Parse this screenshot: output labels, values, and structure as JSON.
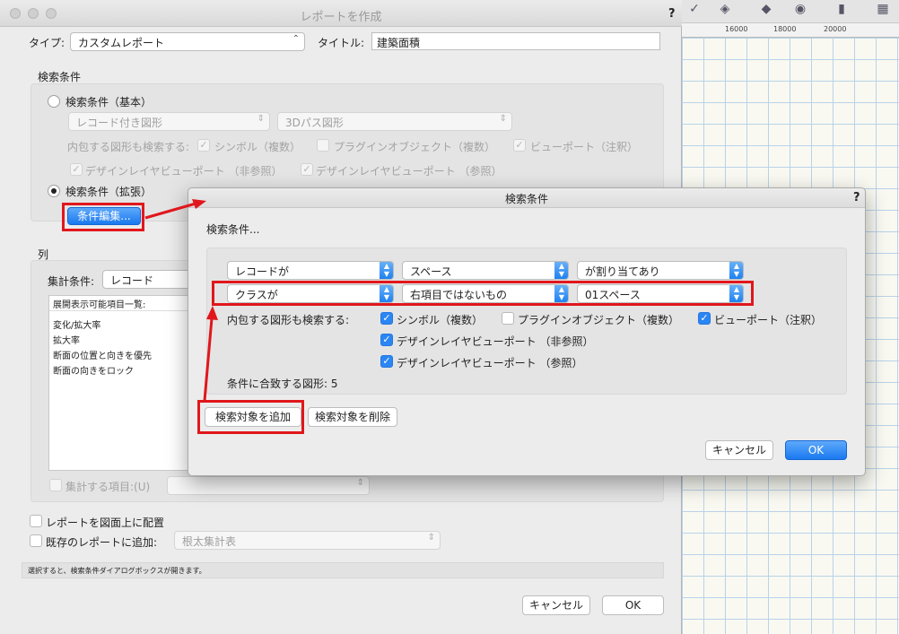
{
  "main_window": {
    "title": "レポートを作成",
    "help": "?",
    "type_label": "タイプ:",
    "type_value": "カスタムレポート",
    "title_label": "タイトル:",
    "title_value": "建築面積",
    "search_group_label": "検索条件",
    "basic_radio_label": "検索条件（基本）",
    "basic_popup1": "レコード付き図形",
    "basic_popup2": "3Dパス図形",
    "include_label": "内包する図形も検索する:",
    "cb_symbol": "シンボル（複数）",
    "cb_plugin": "プラグインオブジェクト（複数）",
    "cb_viewport": "ビューポート（注釈）",
    "cb_dlvp_nonref": "デザインレイヤビューポート （非参照）",
    "cb_dlvp_ref": "デザインレイヤビューポート （参照）",
    "extended_radio_label": "検索条件（拡張）",
    "edit_button": "条件編集...",
    "columns_label": "列",
    "aggregate_label": "集計条件:",
    "aggregate_value": "レコード",
    "list_header": "展開表示可能項目一覧:",
    "list_items": [
      "変化/拡大率",
      "拡大率",
      "断面の位置と向きを優先",
      "断面の向きをロック"
    ],
    "sum_item_label": "集計する項目:(U)",
    "place_on_drawing": "レポートを図面上に配置",
    "add_to_existing": "既存のレポートに追加:",
    "existing_value": "根太集計表",
    "status_text": "選択すると、検索条件ダイアログボックスが開きます。",
    "cancel": "キャンセル",
    "ok": "OK"
  },
  "search_dialog": {
    "title": "検索条件",
    "help": "?",
    "heading": "検索条件...",
    "rows": [
      {
        "a": "レコードが",
        "b": "スペース",
        "c": "が割り当てあり"
      },
      {
        "a": "クラスが",
        "b": "右項目ではないもの",
        "c": "01スペース"
      }
    ],
    "include_label": "内包する図形も検索する:",
    "cb_symbol": "シンボル（複数）",
    "cb_plugin": "プラグインオブジェクト（複数）",
    "cb_viewport": "ビューポート（注釈）",
    "cb_dlvp_nonref": "デザインレイヤビューポート （非参照）",
    "cb_dlvp_ref": "デザインレイヤビューポート （参照）",
    "match_label": "条件に合致する図形: 5",
    "add_target": "検索対象を追加",
    "remove_target": "検索対象を削除",
    "cancel": "キャンセル",
    "ok": "OK"
  },
  "background_app": {
    "ruler_ticks": [
      "16000",
      "18000",
      "20000"
    ]
  },
  "colors": {
    "accent_blue": "#1a79ef",
    "annotation_red": "#e0171c"
  }
}
